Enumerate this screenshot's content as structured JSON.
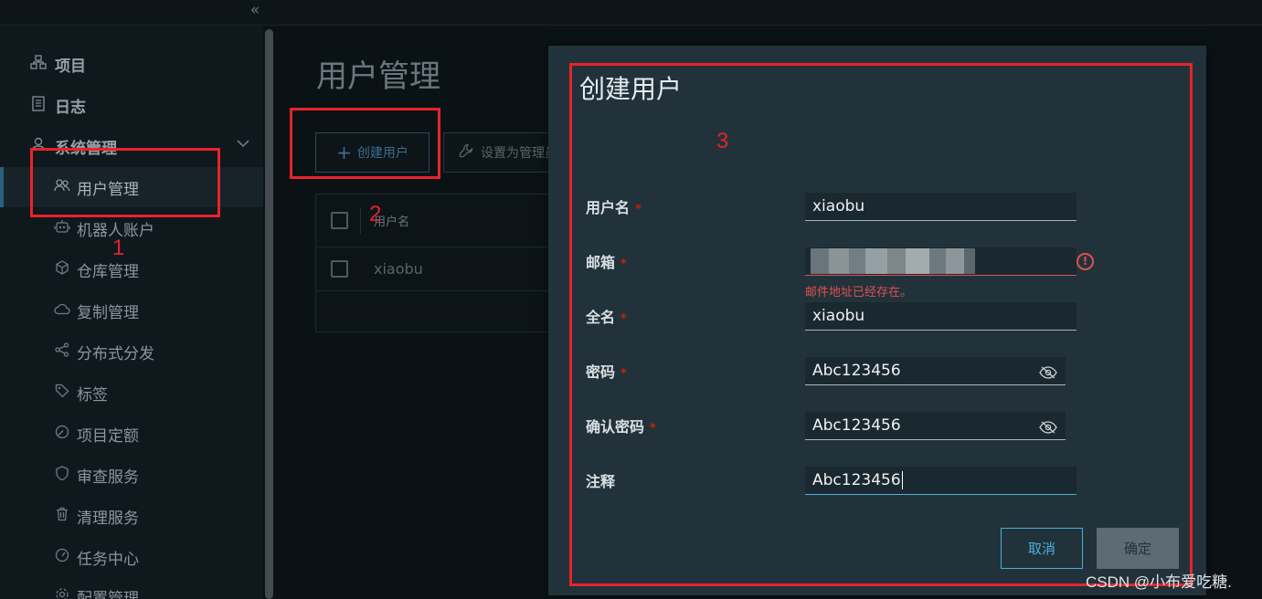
{
  "sidebar": {
    "collapse_icon": "«",
    "items": [
      {
        "label": "项目",
        "icon": "projects-icon"
      },
      {
        "label": "日志",
        "icon": "logs-icon"
      },
      {
        "label": "系统管理",
        "icon": "admin-icon"
      },
      {
        "label": "用户管理",
        "icon": "users-icon",
        "active": true
      },
      {
        "label": "机器人账户",
        "icon": "robot-icon"
      },
      {
        "label": "仓库管理",
        "icon": "registry-icon"
      },
      {
        "label": "复制管理",
        "icon": "cloud-icon"
      },
      {
        "label": "分布式分发",
        "icon": "share-icon"
      },
      {
        "label": "标签",
        "icon": "tag-icon"
      },
      {
        "label": "项目定额",
        "icon": "quota-icon"
      },
      {
        "label": "审查服务",
        "icon": "shield-icon"
      },
      {
        "label": "清理服务",
        "icon": "trash-icon"
      },
      {
        "label": "任务中心",
        "icon": "dashboard-icon"
      },
      {
        "label": "配置管理",
        "icon": "settings-icon"
      }
    ]
  },
  "main": {
    "title": "用户管理",
    "toolbar": {
      "create_label": "创建用户",
      "create_icon": "+",
      "admin_label": "设置为管理员"
    },
    "grid": {
      "header": "用户名",
      "rows": [
        "xiaobu"
      ]
    }
  },
  "annotations": {
    "n1": "1",
    "n2": "2",
    "n3": "3"
  },
  "modal": {
    "title": "创建用户",
    "required_mark": "*",
    "fields": {
      "username": {
        "label": "用户名",
        "value": "xiaobu"
      },
      "email": {
        "label": "邮箱",
        "error": "邮件地址已经存在。",
        "error_icon": "!"
      },
      "fullname": {
        "label": "全名",
        "value": "xiaobu"
      },
      "password": {
        "label": "密码",
        "value": "Abc123456"
      },
      "confirm": {
        "label": "确认密码",
        "value": "Abc123456"
      },
      "comment": {
        "label": "注释",
        "value": "Abc123456"
      }
    },
    "cancel_label": "取消",
    "ok_label": "确定"
  },
  "watermark": "CSDN @小布爱吃糖.",
  "colors": {
    "accent": "#49afd9",
    "error": "#e05050",
    "annotation": "#e8232a",
    "modal_bg": "#21323b"
  }
}
